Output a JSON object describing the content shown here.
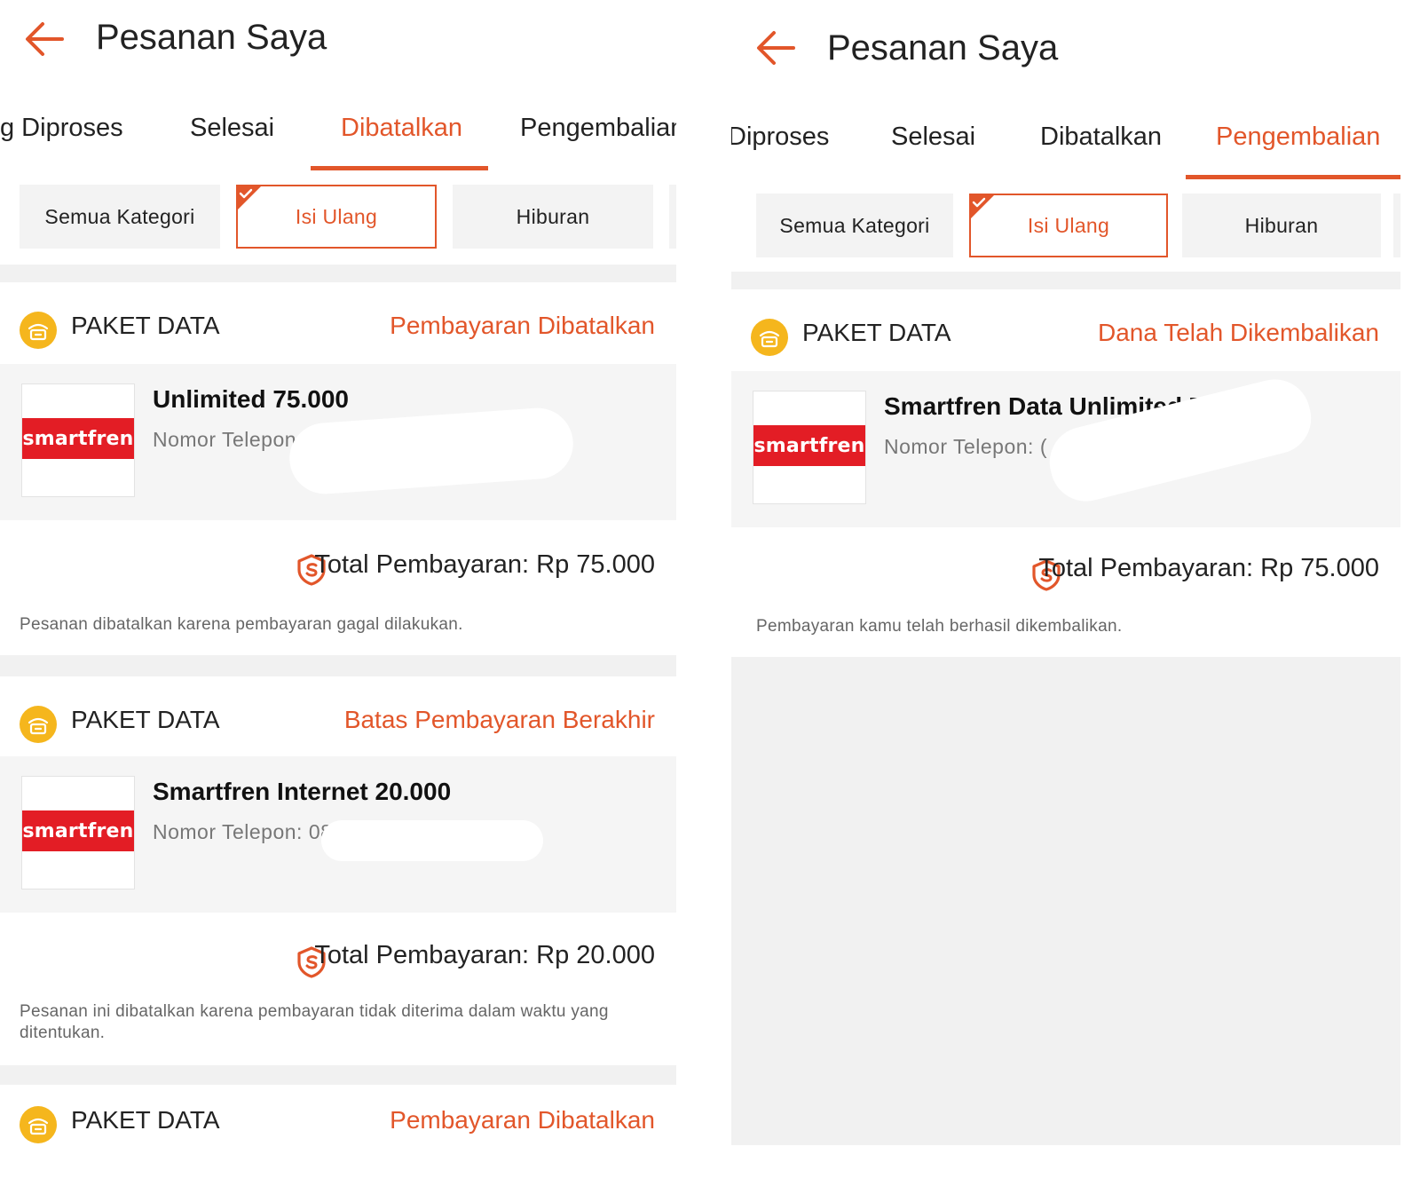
{
  "colors": {
    "accent": "#e2562a",
    "brand_red": "#e31d25",
    "icon_yellow": "#f5b61d",
    "background_gray": "#f1f1f1"
  },
  "left": {
    "title": "Pesanan Saya",
    "tabs": [
      "g Diproses",
      "Selesai",
      "Dibatalkan",
      "Pengembalian"
    ],
    "active_tab": "Dibatalkan",
    "chips": [
      "Semua Kategori",
      "Isi Ulang",
      "Hiburan"
    ],
    "selected_chip": "Isi Ulang",
    "orders": [
      {
        "type": "PAKET DATA",
        "status": "Pembayaran Dibatalkan",
        "logo": "smartfren",
        "product": "Unlimited 75.000",
        "phone": "Nomor Telepon: (",
        "total": "Total Pembayaran: Rp 75.000",
        "note": "Pesanan dibatalkan karena pembayaran gagal dilakukan."
      },
      {
        "type": "PAKET DATA",
        "status": "Batas Pembayaran Berakhir",
        "logo": "smartfren",
        "product": "Smartfren Internet 20.000",
        "phone": "Nomor Telepon: 0881",
        "total": "Total Pembayaran: Rp 20.000",
        "note": "Pesanan ini dibatalkan karena pembayaran tidak diterima dalam waktu yang ditentukan."
      },
      {
        "type": "PAKET DATA",
        "status": "Pembayaran Dibatalkan"
      }
    ]
  },
  "right": {
    "title": "Pesanan Saya",
    "tabs": [
      "Diproses",
      "Selesai",
      "Dibatalkan",
      "Pengembalian"
    ],
    "active_tab": "Pengembalian",
    "chips": [
      "Semua Kategori",
      "Isi Ulang",
      "Hiburan"
    ],
    "selected_chip": "Isi Ulang",
    "orders": [
      {
        "type": "PAKET DATA",
        "status": "Dana Telah Dikembalikan",
        "logo": "smartfren",
        "product": "Smartfren Data Unlimited 75.000",
        "phone": "Nomor Telepon: (",
        "total": "Total Pembayaran: Rp 75.000",
        "note": "Pembayaran kamu telah berhasil dikembalikan."
      }
    ]
  },
  "icons": {
    "back": "arrow-left-icon",
    "package": "paket-data-icon",
    "shield": "shield-icon",
    "check": "check-icon"
  }
}
